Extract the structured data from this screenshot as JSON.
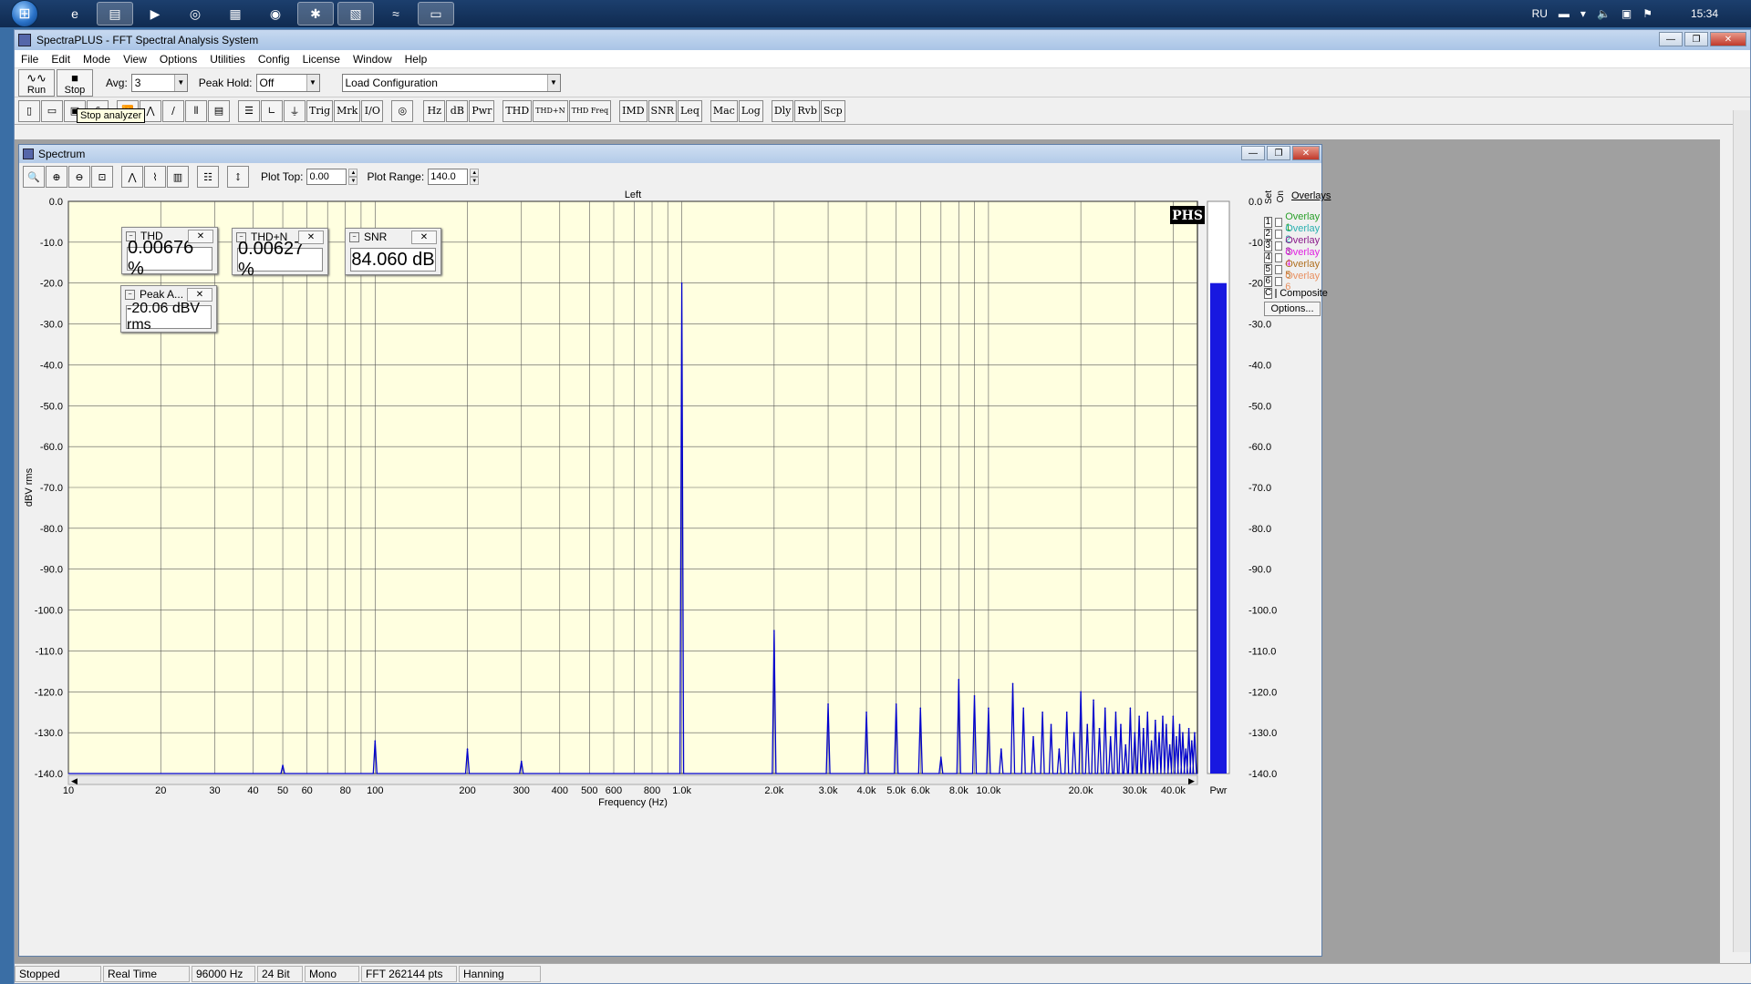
{
  "taskbar": {
    "items": [
      "ie-icon",
      "explorer-icon",
      "media-icon",
      "app-icon",
      "calc-icon",
      "chrome-icon",
      "tool-icon",
      "spectra-icon",
      "wave-icon",
      "window-icon"
    ],
    "tray": {
      "lang": "RU",
      "time": "15:34"
    }
  },
  "window": {
    "title": "SpectraPLUS - FFT Spectral Analysis System",
    "menu": [
      "File",
      "Edit",
      "Mode",
      "View",
      "Options",
      "Utilities",
      "Config",
      "License",
      "Window",
      "Help"
    ]
  },
  "toolbar1": {
    "run_label": "Run",
    "stop_label": "Stop",
    "avg_label": "Avg:",
    "avg_value": "3",
    "peakhold_label": "Peak Hold:",
    "peakhold_value": "Off",
    "loadcfg_value": "Load Configuration",
    "tooltip": "Stop analyzer"
  },
  "toolbar2": {
    "buttons": [
      "Trig",
      "Mrk",
      "I/O",
      "Hz",
      "dB",
      "Pwr",
      "THD",
      "THD+N",
      "THD Freq",
      "IMD",
      "SNR",
      "Leq",
      "Mac",
      "Log",
      "Dly",
      "Rvb",
      "Scp"
    ]
  },
  "spectrum": {
    "title": "Spectrum",
    "plot_top_label": "Plot Top:",
    "plot_top_value": "0.00",
    "plot_range_label": "Plot Range:",
    "plot_range_value": "140.0",
    "channel_label": "Left",
    "logo": "PHS",
    "xlabel": "Frequency (Hz)",
    "ylabel": "dBV rms",
    "pwr_label": "Pwr"
  },
  "meters": {
    "thd": {
      "title": "THD",
      "value": "0.00676 %"
    },
    "thdn": {
      "title": "THD+N",
      "value": "0.00627 %"
    },
    "snr": {
      "title": "SNR",
      "value": "84.060 dB"
    },
    "peak": {
      "title": "Peak A...",
      "value": "-20.06 dBV rms"
    }
  },
  "overlays": {
    "title": "Overlays",
    "set_label": "Set",
    "on_label": "On",
    "rows": [
      {
        "num": "1",
        "label": "Overlay 1",
        "color": "#2aa02a"
      },
      {
        "num": "2",
        "label": "Overlay 2",
        "color": "#2ab0b0"
      },
      {
        "num": "3",
        "label": "Overlay 3",
        "color": "#8a1a8a"
      },
      {
        "num": "4",
        "label": "Overlay 4",
        "color": "#e020e0"
      },
      {
        "num": "5",
        "label": "Overlay 5",
        "color": "#b07020"
      },
      {
        "num": "6",
        "label": "Overlay 6",
        "color": "#e89060"
      },
      {
        "num": "C",
        "label": "Composite",
        "color": "#000000"
      }
    ],
    "options_label": "Options..."
  },
  "status": [
    "Stopped",
    "Real Time",
    "96000 Hz",
    "24 Bit",
    "Mono",
    "FFT 262144 pts",
    "Hanning"
  ],
  "chart_data": {
    "type": "line",
    "title": "",
    "xlabel": "Frequency (Hz)",
    "ylabel": "dBV rms",
    "xscale": "log",
    "xlim": [
      10,
      48000
    ],
    "ylim": [
      -140,
      0
    ],
    "y_ticks": [
      "0.0",
      "-10.0",
      "-20.0",
      "-30.0",
      "-40.0",
      "-50.0",
      "-60.0",
      "-70.0",
      "-80.0",
      "-90.0",
      "-100.0",
      "-110.0",
      "-120.0",
      "-130.0",
      "-140.0"
    ],
    "x_ticks": [
      {
        "v": 10,
        "l": "10"
      },
      {
        "v": 20,
        "l": "20"
      },
      {
        "v": 30,
        "l": "30"
      },
      {
        "v": 40,
        "l": "40"
      },
      {
        "v": 50,
        "l": "50"
      },
      {
        "v": 60,
        "l": "60"
      },
      {
        "v": 80,
        "l": "80"
      },
      {
        "v": 100,
        "l": "100"
      },
      {
        "v": 200,
        "l": "200"
      },
      {
        "v": 300,
        "l": "300"
      },
      {
        "v": 400,
        "l": "400"
      },
      {
        "v": 500,
        "l": "500"
      },
      {
        "v": 600,
        "l": "600"
      },
      {
        "v": 800,
        "l": "800"
      },
      {
        "v": 1000,
        "l": "1.0k"
      },
      {
        "v": 2000,
        "l": "2.0k"
      },
      {
        "v": 3000,
        "l": "3.0k"
      },
      {
        "v": 4000,
        "l": "4.0k"
      },
      {
        "v": 5000,
        "l": "5.0k"
      },
      {
        "v": 6000,
        "l": "6.0k"
      },
      {
        "v": 8000,
        "l": "8.0k"
      },
      {
        "v": 10000,
        "l": "10.0k"
      },
      {
        "v": 20000,
        "l": "20.0k"
      },
      {
        "v": 30000,
        "l": "30.0k"
      },
      {
        "v": 40000,
        "l": "40.0k"
      }
    ],
    "grid": true,
    "series": [
      {
        "color": "#0000cc",
        "peaks": [
          [
            50,
            -138
          ],
          [
            100,
            -132
          ],
          [
            200,
            -134
          ],
          [
            300,
            -137
          ],
          [
            1000,
            -20
          ],
          [
            2000,
            -105
          ],
          [
            3000,
            -123
          ],
          [
            4000,
            -125
          ],
          [
            5000,
            -123
          ],
          [
            6000,
            -124
          ],
          [
            7000,
            -136
          ],
          [
            8000,
            -117
          ],
          [
            9000,
            -121
          ],
          [
            10000,
            -124
          ],
          [
            11000,
            -134
          ],
          [
            12000,
            -118
          ],
          [
            13000,
            -124
          ],
          [
            14000,
            -131
          ],
          [
            15000,
            -125
          ],
          [
            16000,
            -128
          ],
          [
            17000,
            -134
          ],
          [
            18000,
            -125
          ],
          [
            19000,
            -130
          ],
          [
            20000,
            -120
          ],
          [
            21000,
            -128
          ],
          [
            22000,
            -122
          ],
          [
            23000,
            -129
          ],
          [
            24000,
            -124
          ],
          [
            25000,
            -131
          ],
          [
            26000,
            -125
          ],
          [
            27000,
            -128
          ],
          [
            28000,
            -133
          ],
          [
            29000,
            -124
          ],
          [
            30000,
            -130
          ],
          [
            31000,
            -126
          ],
          [
            32000,
            -129
          ],
          [
            33000,
            -125
          ],
          [
            34000,
            -132
          ],
          [
            35000,
            -127
          ],
          [
            36000,
            -130
          ],
          [
            37000,
            -126
          ],
          [
            38000,
            -128
          ],
          [
            39000,
            -133
          ],
          [
            40000,
            -126
          ],
          [
            41000,
            -131
          ],
          [
            42000,
            -128
          ],
          [
            43000,
            -130
          ],
          [
            44000,
            -134
          ],
          [
            45000,
            -129
          ],
          [
            46000,
            -132
          ],
          [
            47000,
            -130
          ]
        ]
      }
    ],
    "pwr_level_db": -20
  }
}
